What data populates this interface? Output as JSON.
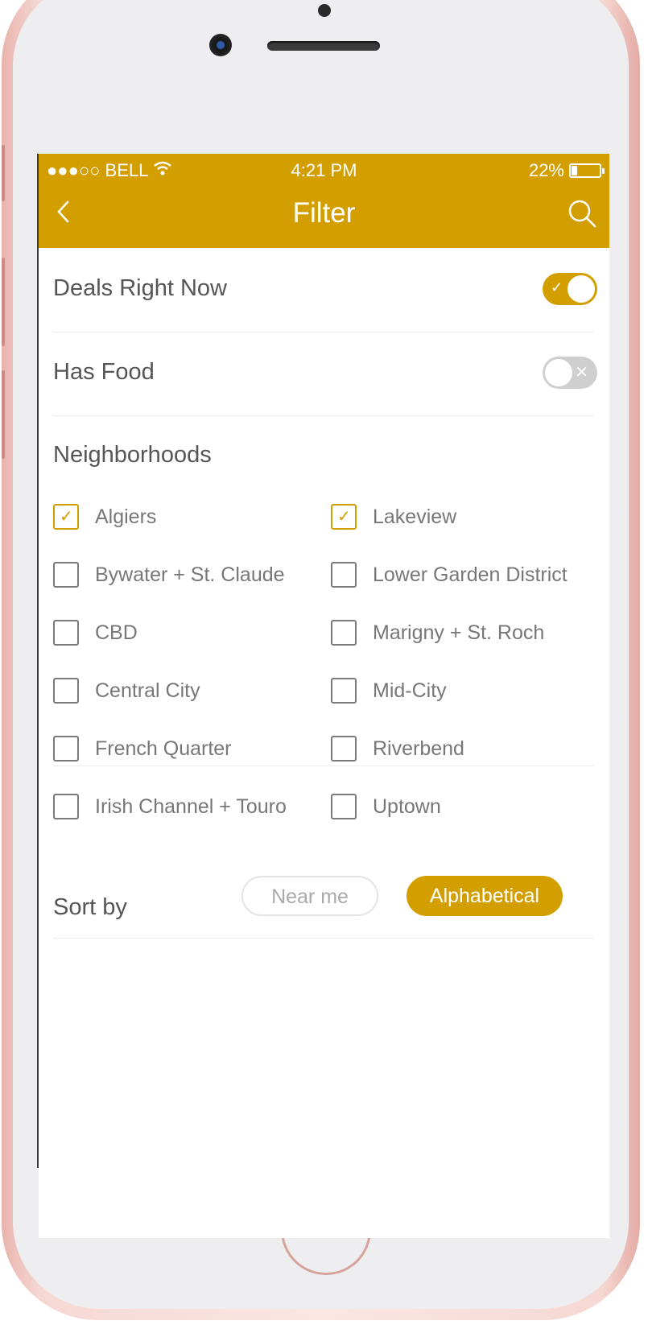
{
  "status_bar": {
    "carrier": "●●●○○ BELL",
    "time": "4:21 PM",
    "battery_percent": "22%",
    "battery_level": 0.22
  },
  "header": {
    "title": "Filter",
    "back_icon": "chevron-left-icon",
    "search_icon": "search-icon"
  },
  "filters": {
    "deals_label": "Deals Right Now",
    "deals_on": true,
    "food_label": "Has Food",
    "food_on": false
  },
  "neighborhoods": {
    "title": "Neighborhoods",
    "left": [
      {
        "label": "Algiers",
        "checked": true
      },
      {
        "label": "Bywater + St. Claude",
        "checked": false
      },
      {
        "label": "CBD",
        "checked": false
      },
      {
        "label": "Central City",
        "checked": false
      },
      {
        "label": "French Quarter",
        "checked": false
      },
      {
        "label": "Irish Channel + Touro",
        "checked": false
      }
    ],
    "right": [
      {
        "label": "Lakeview",
        "checked": true
      },
      {
        "label": "Lower Garden District",
        "checked": false
      },
      {
        "label": "Marigny + St. Roch",
        "checked": false
      },
      {
        "label": "Mid-City",
        "checked": false
      },
      {
        "label": "Riverbend",
        "checked": false
      },
      {
        "label": "Uptown",
        "checked": false
      }
    ]
  },
  "sort": {
    "label": "Sort by",
    "options": [
      "Near me",
      "Alphabetical"
    ],
    "selected": "Alphabetical"
  },
  "colors": {
    "accent": "#d39f00",
    "text": "#555555"
  }
}
